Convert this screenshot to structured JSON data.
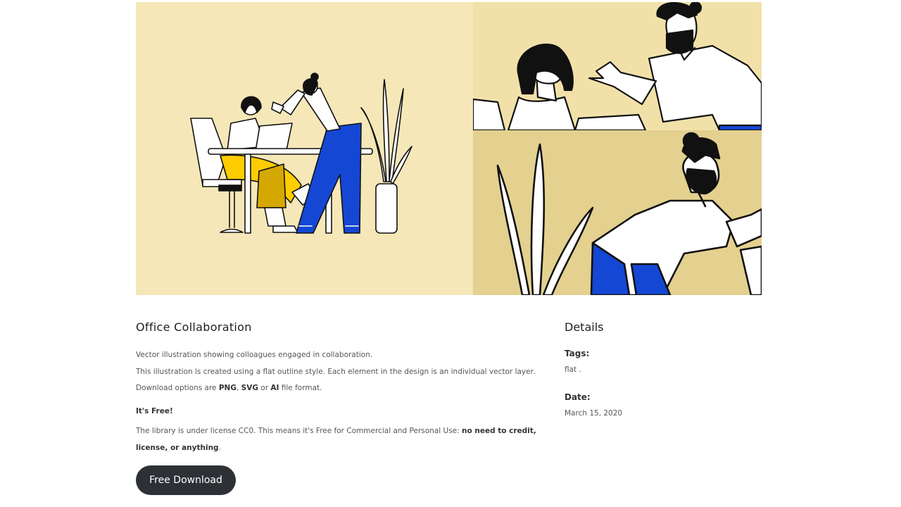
{
  "hero": {
    "main_alt": "Office Collaboration illustration",
    "palette": {
      "bg_main": "#f5e7b8",
      "bg_top": "#f1e1a9",
      "bg_bottom": "#e4d08f",
      "yellow": "#ffcc00",
      "mustard": "#d4a800",
      "blue": "#1447d4",
      "ink": "#111111"
    }
  },
  "article": {
    "title": "Office Collaboration",
    "desc_line1": "Vector illustration showing colloagues engaged in collaboration.",
    "desc_line2": "This illustration is created using a flat outline style. Each element in the design is an individual vector layer.",
    "desc_line3_prefix": "Download options are ",
    "format_png": "PNG",
    "sep_comma": ", ",
    "format_svg": "SVG",
    "sep_or": " or ",
    "format_ai": "AI",
    "desc_line3_suffix": " file format.",
    "free_heading": "It's Free!",
    "license_text": "The library is under license CC0. This means it's Free for Commercial and Personal Use: ",
    "license_bold": "no need to credit, license, or anything",
    "license_end": ".",
    "download_label": "Free Download"
  },
  "details": {
    "heading": "Details",
    "tags_label": "Tags:",
    "tags_value": "flat .",
    "date_label": "Date:",
    "date_value": "March 15, 2020"
  }
}
